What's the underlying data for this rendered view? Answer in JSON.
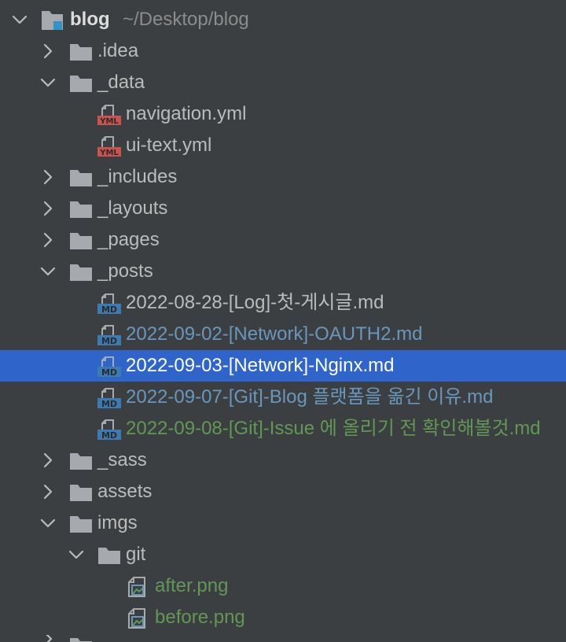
{
  "project": {
    "name": "blog",
    "path": "~/Desktop/blog",
    "icon": "project-folder-icon"
  },
  "colors": {
    "background": "#3c3f41",
    "selection": "#2f65ca",
    "text_default": "#bbbbbb",
    "text_modified": "#6897bb",
    "text_added": "#629755",
    "folder": "#a6a9ad"
  },
  "tree": {
    "idea": ".idea",
    "data": "_data",
    "navigation": "navigation.yml",
    "ui_text": "ui-text.yml",
    "includes": "_includes",
    "layouts": "_layouts",
    "pages": "_pages",
    "posts": "_posts",
    "post1": "2022-08-28-[Log]-첫-게시글.md",
    "post2": "2022-09-02-[Network]-OAUTH2.md",
    "post3": "2022-09-03-[Network]-Nginx.md",
    "post4": "2022-09-07-[Git]-Blog 플랫폼을 옮긴 이유.md",
    "post5": "2022-09-08-[Git]-Issue 에 올리기 전 확인해볼것.md",
    "sass": "_sass",
    "assets": "assets",
    "imgs": "imgs",
    "git": "git",
    "after": "after.png",
    "before": "before.png"
  }
}
